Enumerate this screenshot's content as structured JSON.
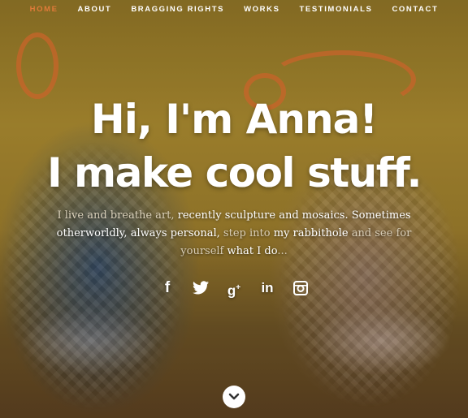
{
  "nav": {
    "items": [
      {
        "label": "HOME",
        "active": true
      },
      {
        "label": "ABOUT",
        "active": false
      },
      {
        "label": "BRAGGING RIGHTS",
        "active": false
      },
      {
        "label": "WORKS",
        "active": false
      },
      {
        "label": "TESTIMONIALS",
        "active": false
      },
      {
        "label": "CONTACT",
        "active": false
      }
    ],
    "active_color": "#e07b39"
  },
  "hero": {
    "line1": "Hi, I'm Anna!",
    "line2": "I make cool stuff.",
    "intro": {
      "p1": "I live and breathe art,",
      "p2": "recently sculpture and mosaics.",
      "p3": "Sometimes",
      "p4": "otherworldly,",
      "p5": "always personal,",
      "p6": "step into",
      "p7": "my rabbithole",
      "p8": "and see for yourself",
      "p9": "what I do",
      "p10": "..."
    }
  },
  "social": [
    {
      "icon": "facebook-icon",
      "glyph": "f"
    },
    {
      "icon": "twitter-icon",
      "glyph": "twitter"
    },
    {
      "icon": "google-plus-icon",
      "glyph": "g+"
    },
    {
      "icon": "linkedin-icon",
      "glyph": "in"
    },
    {
      "icon": "instagram-icon",
      "glyph": "instagram"
    }
  ],
  "scroll": {
    "icon": "chevron-down-icon"
  }
}
